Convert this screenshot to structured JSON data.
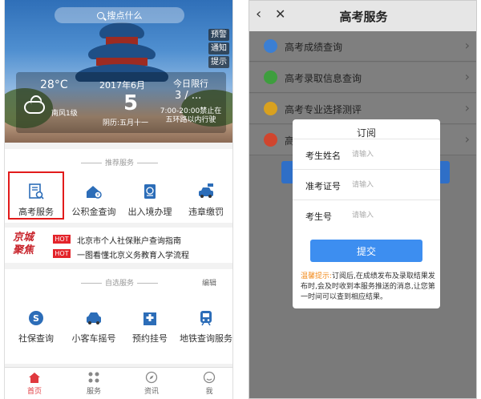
{
  "left": {
    "search_placeholder": "搜点什么",
    "side_buttons": [
      "预警",
      "通知",
      "提示"
    ],
    "weather": {
      "temperature": "28°C",
      "wind": "南风1级",
      "date": "2017年6月",
      "day": "5",
      "lunar": "阴历:五月十一",
      "limit_label": "今日限行",
      "limit_numbers": "3 / ...",
      "limit_text": "7:00-20:00禁止在五环路以内行驶"
    },
    "recommended_label": "推荐服务",
    "services": [
      {
        "label": "高考服务"
      },
      {
        "label": "公积金查询"
      },
      {
        "label": "出入境办理"
      },
      {
        "label": "违章缴罚"
      }
    ],
    "news": {
      "logo": "京城聚焦",
      "items": [
        {
          "badge": "HOT",
          "text": "北京市个人社保账户查询指南"
        },
        {
          "badge": "HOT",
          "text": "一图看懂北京义务教育入学流程"
        }
      ]
    },
    "selected_label": "自选服务",
    "edit_label": "编辑",
    "my_services": [
      {
        "label": "社保查询"
      },
      {
        "label": "小客车摇号"
      },
      {
        "label": "预约挂号"
      },
      {
        "label": "地铁查询服务"
      }
    ],
    "tabs": [
      {
        "label": "首页"
      },
      {
        "label": "服务"
      },
      {
        "label": "资讯"
      },
      {
        "label": "我"
      }
    ]
  },
  "right": {
    "title": "高考服务",
    "back_icon": "‹",
    "close_icon": "✕",
    "list": [
      {
        "label": "高考成绩查询",
        "color": "#3b7fd4"
      },
      {
        "label": "高考录取信息查询",
        "color": "#3e9e3e"
      },
      {
        "label": "高考专业选择测评",
        "color": "#d9a11f"
      },
      {
        "label": "高",
        "color": "#d0452e"
      }
    ],
    "modal": {
      "title": "订阅",
      "fields": [
        {
          "label": "考生姓名",
          "placeholder": "请输入"
        },
        {
          "label": "准考证号",
          "placeholder": "请输入"
        },
        {
          "label": "考生号",
          "placeholder": "请输入"
        }
      ],
      "submit_label": "提交",
      "tip_head": "温馨提示:",
      "tip_body": "订阅后,在成绩发布及录取结果发布时,会及时收到本服务推送的消息,让您第一时间可以查到相应结果。"
    }
  },
  "colors": {
    "accent_red": "#e21b1b",
    "primary_blue": "#3d8ef0",
    "tab_active": "#e0393e"
  }
}
